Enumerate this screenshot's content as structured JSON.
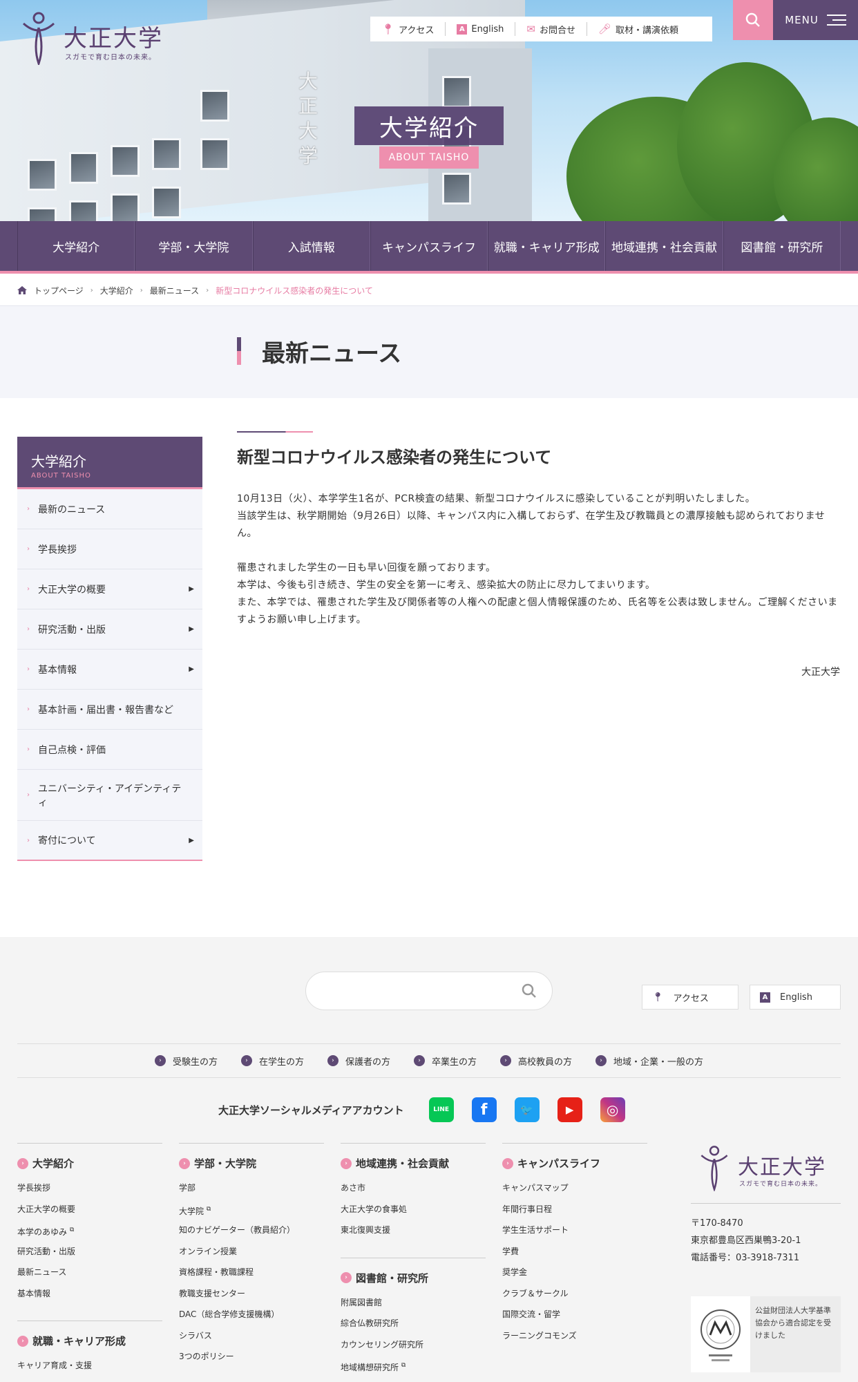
{
  "brand": {
    "name": "大正大学",
    "tagline": "スガモで育む日本の未来。"
  },
  "hero": {
    "building_sign": "大正大学",
    "title": "大学紹介",
    "subtitle": "ABOUT TAISHO"
  },
  "utility_nav": [
    {
      "label": "アクセス",
      "icon": "pin-icon"
    },
    {
      "label": "English",
      "icon": "letter-a-icon"
    },
    {
      "label": "お問合せ",
      "icon": "mail-icon"
    },
    {
      "label": "取材・講演依頼",
      "icon": "microphone-icon"
    }
  ],
  "menu_label": "MENU",
  "global_nav": [
    "大学紹介",
    "学部・大学院",
    "入試情報",
    "キャンパスライフ",
    "就職・キャリア形成",
    "地域連携・社会貢献",
    "図書館・研究所"
  ],
  "breadcrumb": [
    "トップページ",
    "大学紹介",
    "最新ニュース",
    "新型コロナウイルス感染者の発生について"
  ],
  "page_title": "最新ニュース",
  "sidebar": {
    "title": "大学紹介",
    "subtitle": "ABOUT TAISHO",
    "items": [
      {
        "label": "最新のニュース",
        "has_arrow": false
      },
      {
        "label": "学長挨拶",
        "has_arrow": false
      },
      {
        "label": "大正大学の概要",
        "has_arrow": true
      },
      {
        "label": "研究活動・出版",
        "has_arrow": true
      },
      {
        "label": "基本情報",
        "has_arrow": true
      },
      {
        "label": "基本計画・届出書・報告書など",
        "has_arrow": false
      },
      {
        "label": "自己点検・評価",
        "has_arrow": false
      },
      {
        "label": "ユニバーシティ・アイデンティティ",
        "has_arrow": false
      },
      {
        "label": "寄付について",
        "has_arrow": true
      }
    ]
  },
  "article": {
    "title": "新型コロナウイルス感染者の発生について",
    "paragraphs": [
      [
        "10月13日（火）、本学学生1名が、PCR検査の結果、新型コロナウイルスに感染していることが判明いたしました。",
        "当該学生は、秋学期開始（9月26日）以降、キャンパス内に入構しておらず、在学生及び教職員との濃厚接触も認められておりません。"
      ],
      [
        "罹患されました学生の一日も早い回復を願っております。",
        "本学は、今後も引き続き、学生の安全を第一に考え、感染拡大の防止に尽力してまいります。",
        "また、本学では、罹患された学生及び関係者等の人権への配慮と個人情報保護のため、氏名等を公表は致しません。ご理解くださいますようお願い申し上げます。"
      ]
    ],
    "signature": "大正大学"
  },
  "footer": {
    "search_placeholder": "",
    "buttons": [
      {
        "label": "アクセス",
        "icon": "pin-icon"
      },
      {
        "label": "English",
        "icon": "letter-a-icon"
      }
    ],
    "audiences": [
      "受験生の方",
      "在学生の方",
      "保護者の方",
      "卒業生の方",
      "高校教員の方",
      "地域・企業・一般の方"
    ],
    "social_label": "大正大学ソーシャルメディアアカウント",
    "social": [
      {
        "name": "line-icon",
        "glyph": "LINE",
        "color": "#06c755"
      },
      {
        "name": "facebook-icon",
        "glyph": "f",
        "color": "#1877f2"
      },
      {
        "name": "twitter-icon",
        "glyph": "🐦",
        "color": "#1da1f2"
      },
      {
        "name": "youtube-icon",
        "glyph": "▶",
        "color": "#e62117"
      },
      {
        "name": "instagram-icon",
        "glyph": "◎",
        "color": "#c13584"
      }
    ],
    "columns": [
      {
        "head": "大学紹介",
        "links": [
          {
            "t": "学長挨拶"
          },
          {
            "t": "大正大学の概要"
          },
          {
            "t": "本学のあゆみ",
            "ext": true
          },
          {
            "t": "研究活動・出版"
          },
          {
            "t": "最新ニュース"
          },
          {
            "t": "基本情報"
          }
        ],
        "sub": {
          "head": "就職・キャリア形成",
          "links": [
            {
              "t": "キャリア育成・支援"
            }
          ]
        }
      },
      {
        "head": "学部・大学院",
        "links": [
          {
            "t": "学部"
          },
          {
            "t": "大学院",
            "ext": true
          },
          {
            "t": "知のナビゲーター（教員紹介）"
          },
          {
            "t": "オンライン授業"
          },
          {
            "t": "資格課程・教職課程"
          },
          {
            "t": "教職支援センター"
          },
          {
            "t": "DAC（総合学修支援機構）"
          },
          {
            "t": "シラバス"
          },
          {
            "t": "3つのポリシー"
          }
        ]
      },
      {
        "head": "地域連携・社会貢献",
        "links": [
          {
            "t": "あさ市"
          },
          {
            "t": "大正大学の食事処"
          },
          {
            "t": "東北復興支援"
          }
        ],
        "sub": {
          "head": "図書館・研究所",
          "links": [
            {
              "t": "附属図書館"
            },
            {
              "t": "綜合仏教研究所"
            },
            {
              "t": "カウンセリング研究所"
            },
            {
              "t": "地域構想研究所",
              "ext": true
            }
          ]
        }
      },
      {
        "head": "キャンパスライフ",
        "links": [
          {
            "t": "キャンパスマップ"
          },
          {
            "t": "年間行事日程"
          },
          {
            "t": "学生生活サポート"
          },
          {
            "t": "学費"
          },
          {
            "t": "奨学金"
          },
          {
            "t": "クラブ＆サークル"
          },
          {
            "t": "国際交流・留学"
          },
          {
            "t": "ラーニングコモンズ"
          }
        ]
      }
    ],
    "address": [
      "〒170-8470",
      "東京都豊島区西巣鴨3-20-1",
      "電話番号：03-3918-7311"
    ],
    "badge_text": "公益財団法人大学基準協会から適合認定を受けました"
  },
  "colors": {
    "purple": "#5e4a74",
    "pink": "#ee8fae"
  }
}
